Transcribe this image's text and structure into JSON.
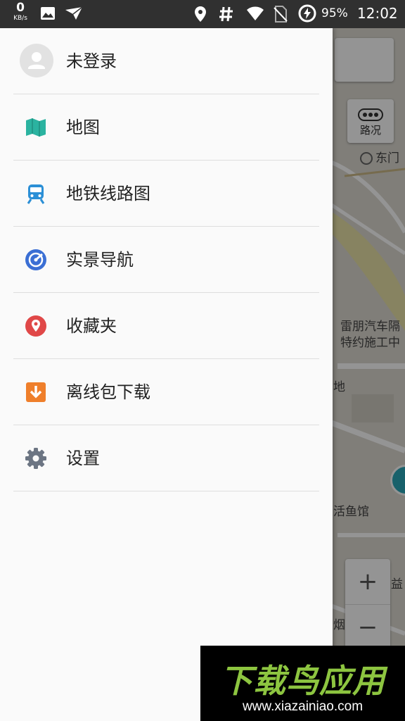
{
  "status_bar": {
    "net_speed_value": "0",
    "net_speed_unit": "KB/s",
    "battery_percent": "95%",
    "time": "12:02",
    "icons": [
      "image-icon",
      "send-icon",
      "location-icon",
      "hash-icon",
      "wifi-icon",
      "no-sim-icon",
      "battery-charging-icon"
    ]
  },
  "drawer": {
    "user": {
      "label": "未登录",
      "icon": "avatar-icon"
    },
    "items": [
      {
        "label": "地图",
        "icon": "map-icon",
        "color": "#2bb3a0"
      },
      {
        "label": "地铁线路图",
        "icon": "subway-icon",
        "color": "#2b8fd6"
      },
      {
        "label": "实景导航",
        "icon": "compass-icon",
        "color": "#3b6fd4"
      },
      {
        "label": "收藏夹",
        "icon": "location-pin-icon",
        "color": "#e04848"
      },
      {
        "label": "离线包下载",
        "icon": "download-icon",
        "color": "#ef7f2b"
      },
      {
        "label": "设置",
        "icon": "gear-icon",
        "color": "#6c7583"
      }
    ]
  },
  "map": {
    "traffic_label": "路况",
    "labels": {
      "east_gate": "东门",
      "poi_1": "雷朋汽车隔",
      "poi_2": "特约施工中",
      "partial_di": "地",
      "restaurant": "活鱼馆",
      "partial_yi": "益",
      "partial_yan": "烟"
    },
    "zoom_in": "+",
    "zoom_out": "−"
  },
  "watermark": {
    "logo_text": "下载鸟应用",
    "url": "www.xiazainiao.com"
  }
}
